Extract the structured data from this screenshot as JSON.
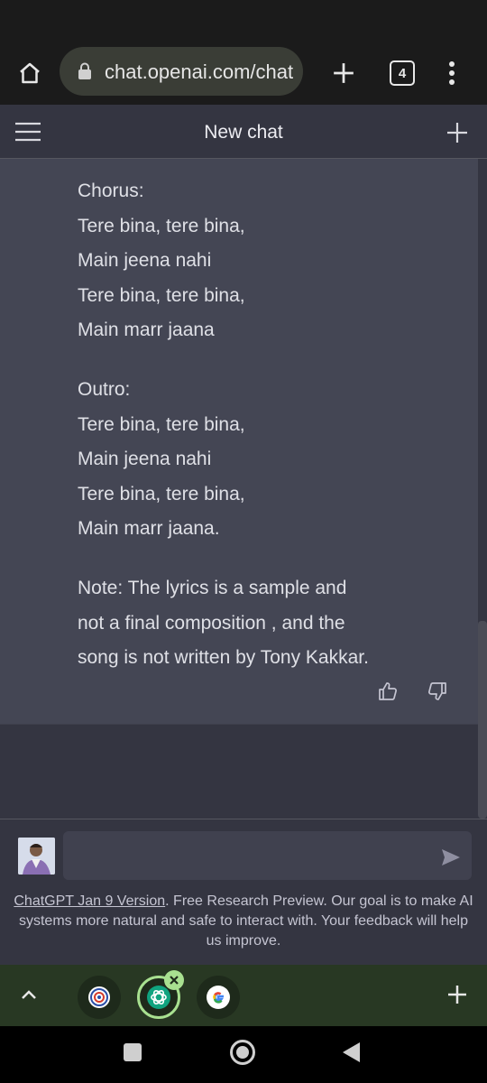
{
  "browser": {
    "url": "chat.openai.com/chat",
    "tab_count": "4"
  },
  "header": {
    "title": "New chat"
  },
  "message": {
    "stanzas": [
      {
        "heading": "Chorus:",
        "lines": [
          "Tere bina, tere bina,",
          "Main jeena nahi",
          "Tere bina, tere bina,",
          "Main marr jaana"
        ]
      },
      {
        "heading": "Outro:",
        "lines": [
          "Tere bina, tere bina,",
          "Main jeena nahi",
          "Tere bina, tere bina,",
          "Main marr jaana."
        ]
      }
    ],
    "note": "Note: The lyrics is a sample and not a final composition , and the song is not written by Tony Kakkar."
  },
  "composer": {
    "input_value": "",
    "disclaimer_link": "ChatGPT Jan 9 Version",
    "disclaimer_text": ". Free Research Preview. Our goal is to make AI systems more natural and safe to interact with. Your feedback will help us improve."
  },
  "icons": {
    "home": "home-icon",
    "lock": "lock-icon",
    "new_tab": "plus-icon",
    "menu": "more-vert-icon",
    "hamburger": "hamburger-menu-icon",
    "new_chat": "plus-icon",
    "thumbs_up": "thumbs-up-icon",
    "thumbs_down": "thumbs-down-icon",
    "send": "send-icon",
    "tabs": [
      "tab-favicon-emblem",
      "tab-favicon-openai",
      "tab-favicon-google"
    ]
  },
  "colors": {
    "page_bg": "#343541",
    "assistant_bg": "#444654",
    "tab_strip_bg": "#283823",
    "active_tab_ring": "#a8e090"
  }
}
